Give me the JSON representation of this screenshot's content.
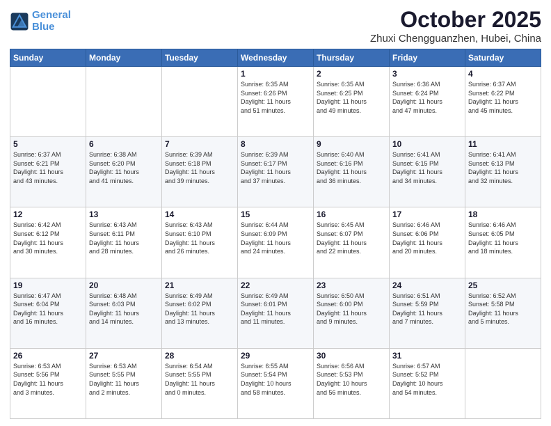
{
  "logo": {
    "line1": "General",
    "line2": "Blue"
  },
  "header": {
    "title": "October 2025",
    "subtitle": "Zhuxi Chengguanzhen, Hubei, China"
  },
  "weekdays": [
    "Sunday",
    "Monday",
    "Tuesday",
    "Wednesday",
    "Thursday",
    "Friday",
    "Saturday"
  ],
  "weeks": [
    [
      {
        "day": "",
        "info": ""
      },
      {
        "day": "",
        "info": ""
      },
      {
        "day": "",
        "info": ""
      },
      {
        "day": "1",
        "info": "Sunrise: 6:35 AM\nSunset: 6:26 PM\nDaylight: 11 hours\nand 51 minutes."
      },
      {
        "day": "2",
        "info": "Sunrise: 6:35 AM\nSunset: 6:25 PM\nDaylight: 11 hours\nand 49 minutes."
      },
      {
        "day": "3",
        "info": "Sunrise: 6:36 AM\nSunset: 6:24 PM\nDaylight: 11 hours\nand 47 minutes."
      },
      {
        "day": "4",
        "info": "Sunrise: 6:37 AM\nSunset: 6:22 PM\nDaylight: 11 hours\nand 45 minutes."
      }
    ],
    [
      {
        "day": "5",
        "info": "Sunrise: 6:37 AM\nSunset: 6:21 PM\nDaylight: 11 hours\nand 43 minutes."
      },
      {
        "day": "6",
        "info": "Sunrise: 6:38 AM\nSunset: 6:20 PM\nDaylight: 11 hours\nand 41 minutes."
      },
      {
        "day": "7",
        "info": "Sunrise: 6:39 AM\nSunset: 6:18 PM\nDaylight: 11 hours\nand 39 minutes."
      },
      {
        "day": "8",
        "info": "Sunrise: 6:39 AM\nSunset: 6:17 PM\nDaylight: 11 hours\nand 37 minutes."
      },
      {
        "day": "9",
        "info": "Sunrise: 6:40 AM\nSunset: 6:16 PM\nDaylight: 11 hours\nand 36 minutes."
      },
      {
        "day": "10",
        "info": "Sunrise: 6:41 AM\nSunset: 6:15 PM\nDaylight: 11 hours\nand 34 minutes."
      },
      {
        "day": "11",
        "info": "Sunrise: 6:41 AM\nSunset: 6:13 PM\nDaylight: 11 hours\nand 32 minutes."
      }
    ],
    [
      {
        "day": "12",
        "info": "Sunrise: 6:42 AM\nSunset: 6:12 PM\nDaylight: 11 hours\nand 30 minutes."
      },
      {
        "day": "13",
        "info": "Sunrise: 6:43 AM\nSunset: 6:11 PM\nDaylight: 11 hours\nand 28 minutes."
      },
      {
        "day": "14",
        "info": "Sunrise: 6:43 AM\nSunset: 6:10 PM\nDaylight: 11 hours\nand 26 minutes."
      },
      {
        "day": "15",
        "info": "Sunrise: 6:44 AM\nSunset: 6:09 PM\nDaylight: 11 hours\nand 24 minutes."
      },
      {
        "day": "16",
        "info": "Sunrise: 6:45 AM\nSunset: 6:07 PM\nDaylight: 11 hours\nand 22 minutes."
      },
      {
        "day": "17",
        "info": "Sunrise: 6:46 AM\nSunset: 6:06 PM\nDaylight: 11 hours\nand 20 minutes."
      },
      {
        "day": "18",
        "info": "Sunrise: 6:46 AM\nSunset: 6:05 PM\nDaylight: 11 hours\nand 18 minutes."
      }
    ],
    [
      {
        "day": "19",
        "info": "Sunrise: 6:47 AM\nSunset: 6:04 PM\nDaylight: 11 hours\nand 16 minutes."
      },
      {
        "day": "20",
        "info": "Sunrise: 6:48 AM\nSunset: 6:03 PM\nDaylight: 11 hours\nand 14 minutes."
      },
      {
        "day": "21",
        "info": "Sunrise: 6:49 AM\nSunset: 6:02 PM\nDaylight: 11 hours\nand 13 minutes."
      },
      {
        "day": "22",
        "info": "Sunrise: 6:49 AM\nSunset: 6:01 PM\nDaylight: 11 hours\nand 11 minutes."
      },
      {
        "day": "23",
        "info": "Sunrise: 6:50 AM\nSunset: 6:00 PM\nDaylight: 11 hours\nand 9 minutes."
      },
      {
        "day": "24",
        "info": "Sunrise: 6:51 AM\nSunset: 5:59 PM\nDaylight: 11 hours\nand 7 minutes."
      },
      {
        "day": "25",
        "info": "Sunrise: 6:52 AM\nSunset: 5:58 PM\nDaylight: 11 hours\nand 5 minutes."
      }
    ],
    [
      {
        "day": "26",
        "info": "Sunrise: 6:53 AM\nSunset: 5:56 PM\nDaylight: 11 hours\nand 3 minutes."
      },
      {
        "day": "27",
        "info": "Sunrise: 6:53 AM\nSunset: 5:55 PM\nDaylight: 11 hours\nand 2 minutes."
      },
      {
        "day": "28",
        "info": "Sunrise: 6:54 AM\nSunset: 5:55 PM\nDaylight: 11 hours\nand 0 minutes."
      },
      {
        "day": "29",
        "info": "Sunrise: 6:55 AM\nSunset: 5:54 PM\nDaylight: 10 hours\nand 58 minutes."
      },
      {
        "day": "30",
        "info": "Sunrise: 6:56 AM\nSunset: 5:53 PM\nDaylight: 10 hours\nand 56 minutes."
      },
      {
        "day": "31",
        "info": "Sunrise: 6:57 AM\nSunset: 5:52 PM\nDaylight: 10 hours\nand 54 minutes."
      },
      {
        "day": "",
        "info": ""
      }
    ]
  ]
}
